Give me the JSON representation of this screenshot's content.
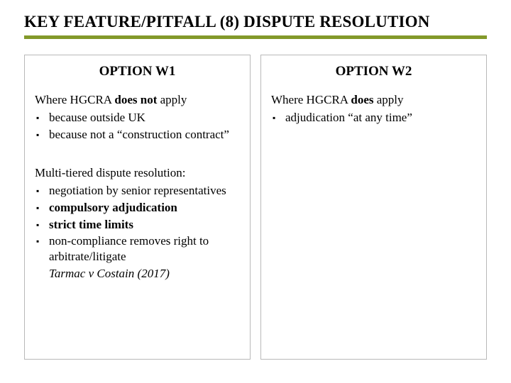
{
  "title": "KEY FEATURE/PITFALL (8) DISPUTE RESOLUTION",
  "left": {
    "heading": "OPTION W1",
    "intro_pre": "Where HGCRA ",
    "intro_strong": "does not",
    "intro_post": " apply",
    "bullets1": [
      "because outside UK",
      "because not a “construction contract”"
    ],
    "para2": "Multi-tiered dispute resolution:",
    "bullets2": [
      {
        "text": "negotiation by senior representatives",
        "bold": false
      },
      {
        "text": "compulsory adjudication",
        "bold": true
      },
      {
        "text": "strict time limits",
        "bold": true
      },
      {
        "text": "non-compliance removes right to arbitrate/litigate",
        "bold": false
      }
    ],
    "case": "Tarmac v Costain (2017)"
  },
  "right": {
    "heading": "OPTION W2",
    "intro_pre": "Where HGCRA ",
    "intro_strong": "does",
    "intro_post": " apply",
    "bullets": [
      "adjudication “at any time”"
    ]
  }
}
